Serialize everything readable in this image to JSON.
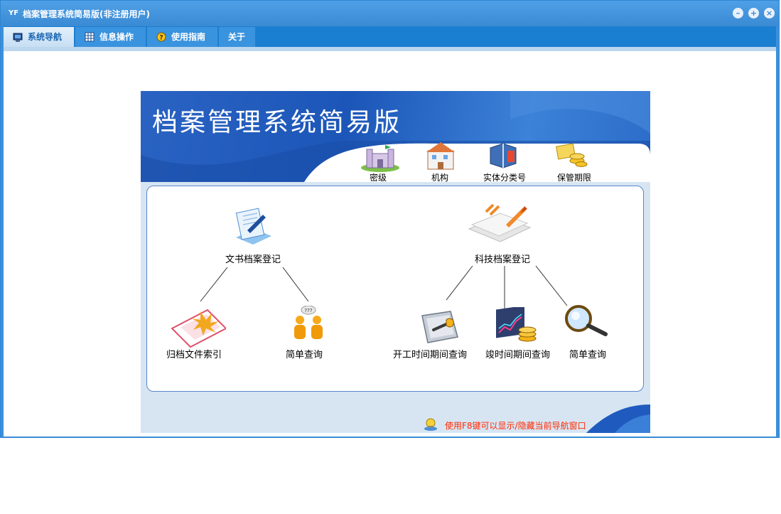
{
  "window": {
    "title": "档案管理系统简易版(非注册用户)",
    "app_icon": "yf-logo-icon",
    "controls": [
      "minimize-icon",
      "restore-icon",
      "close-icon"
    ]
  },
  "menu": {
    "tabs": [
      {
        "label": "系统导航",
        "icon": "monitor-icon",
        "active": true
      },
      {
        "label": "信息操作",
        "icon": "grid-icon",
        "active": false
      },
      {
        "label": "使用指南",
        "icon": "help-icon",
        "active": false
      },
      {
        "label": "关于",
        "icon": "",
        "active": false
      }
    ]
  },
  "nav": {
    "banner_title": "档案管理系统简易版",
    "top_items": [
      "密级",
      "机构",
      "实体分类号",
      "保管期限"
    ],
    "doc": {
      "root": "文书档案登记",
      "children": [
        "归档文件索引",
        "简单查询"
      ]
    },
    "tech": {
      "root": "科技档案登记",
      "children": [
        "开工时间期间查询",
        "竣时间期间查询",
        "简单查询"
      ]
    },
    "tip": "使用F8键可以显示/隐藏当前导航窗口"
  },
  "colors": {
    "title_bar": "#3d90d9",
    "menu_bar": "#1b7fd1",
    "banner": "#2a63c2",
    "tip_text": "#ff2a00"
  }
}
